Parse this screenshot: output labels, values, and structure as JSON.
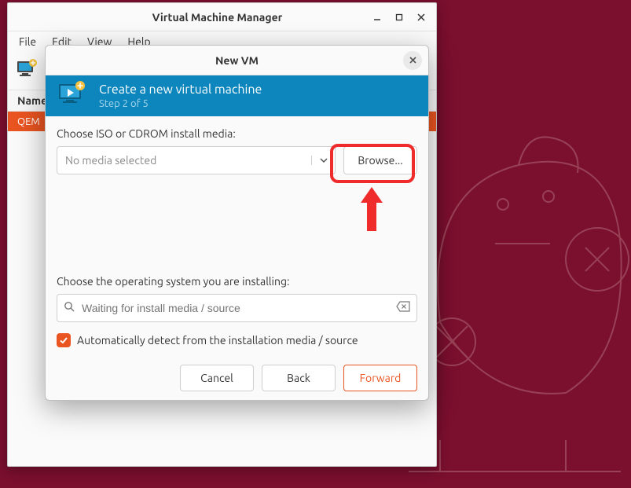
{
  "main_window": {
    "title": "Virtual Machine Manager",
    "menu": {
      "file": "File",
      "edit": "Edit",
      "view": "View",
      "help": "Help"
    },
    "list_header": "Name",
    "list_row": "QEM"
  },
  "dialog": {
    "title": "New VM",
    "banner": {
      "title": "Create a new virtual machine",
      "step": "Step 2 of 5"
    },
    "media_label": "Choose ISO or CDROM install media:",
    "media_placeholder": "No media selected",
    "browse": "Browse...",
    "os_label": "Choose the operating system you are installing:",
    "os_placeholder": "Waiting for install media / source",
    "autodetect": "Automatically detect from the installation media / source",
    "buttons": {
      "cancel": "Cancel",
      "back": "Back",
      "forward": "Forward"
    }
  }
}
